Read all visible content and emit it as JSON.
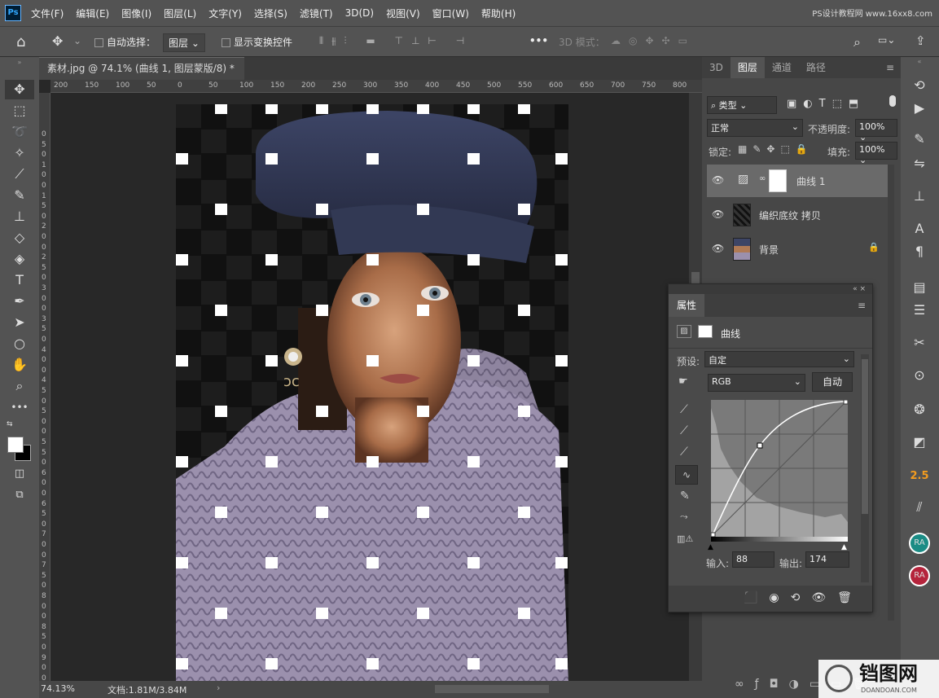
{
  "app": {
    "logo": "Ps",
    "brand": "PS设计教程网 www.16xx8.com"
  },
  "menu": [
    "文件(F)",
    "编辑(E)",
    "图像(I)",
    "图层(L)",
    "文字(Y)",
    "选择(S)",
    "滤镜(T)",
    "3D(D)",
    "视图(V)",
    "窗口(W)",
    "帮助(H)"
  ],
  "options": {
    "auto_select": "自动选择：",
    "layer_dropdown": "图层",
    "show_transform": "显示变换控件",
    "mode3d": "3D 模式："
  },
  "document": {
    "tab_title": "素材.jpg @ 74.1% (曲线 1, 图层蒙版/8) *",
    "close": "×"
  },
  "ruler_h": [
    "200",
    "150",
    "100",
    "50",
    "0",
    "50",
    "100",
    "150",
    "200",
    "250",
    "300",
    "350",
    "400",
    "450",
    "500",
    "550",
    "600",
    "650",
    "700",
    "750",
    "800",
    "850"
  ],
  "ruler_v": [
    "0",
    "5",
    "0",
    "1",
    "0",
    "0",
    "1",
    "5",
    "0",
    "2",
    "0",
    "0",
    "2",
    "5",
    "0",
    "3",
    "0",
    "0",
    "3",
    "5",
    "0",
    "4",
    "0",
    "0",
    "4",
    "5",
    "0",
    "5",
    "0",
    "0",
    "5",
    "5",
    "0",
    "6",
    "0",
    "0",
    "6",
    "5",
    "0",
    "7",
    "0",
    "0",
    "7",
    "5",
    "0",
    "8",
    "0",
    "0",
    "8",
    "5",
    "0",
    "9",
    "0",
    "0",
    "9",
    "5",
    "0"
  ],
  "status": {
    "zoom": "74.13%",
    "doc": "文档:1.81M/3.84M"
  },
  "layers_panel": {
    "tabs": [
      "3D",
      "图层",
      "通道",
      "路径"
    ],
    "active_tab": "图层",
    "filter": "类型",
    "blend": "正常",
    "opacity_label": "不透明度:",
    "opacity": "100%",
    "lock_label": "锁定:",
    "fill_label": "填充:",
    "fill": "100%",
    "layers": [
      {
        "name": "曲线 1",
        "selected": true
      },
      {
        "name": "编织底纹 拷贝",
        "selected": false
      },
      {
        "name": "背景",
        "selected": false
      }
    ]
  },
  "properties": {
    "title": "属性",
    "type": "曲线",
    "preset_label": "预设:",
    "preset": "自定",
    "channel": "RGB",
    "auto": "自动",
    "input_label": "输入:",
    "input": "88",
    "output_label": "输出:",
    "output": "174"
  },
  "right_icons": [
    "history-icon",
    "play-icon",
    "brush-settings-icon",
    "adjust-icon",
    "clone-source-icon",
    "character-icon",
    "paragraph-icon",
    "libraries-icon",
    "notes-icon",
    "tool-presets-icon",
    "navigator-icon",
    "cc-icon",
    "layer-comps-icon",
    "brush-icon"
  ],
  "right_labels": {
    "version": "2.5",
    "ra1": "RA",
    "ra2": "RA"
  },
  "watermark": {
    "text": "铛图网",
    "sub": "DOANDOAN.COM"
  },
  "colors": {
    "accent": "#31a8ff",
    "panel": "#474747",
    "menubar": "#535353",
    "orange": "#f39c1f",
    "ra_teal": "#1b8c85",
    "ra_red": "#b5243c"
  }
}
